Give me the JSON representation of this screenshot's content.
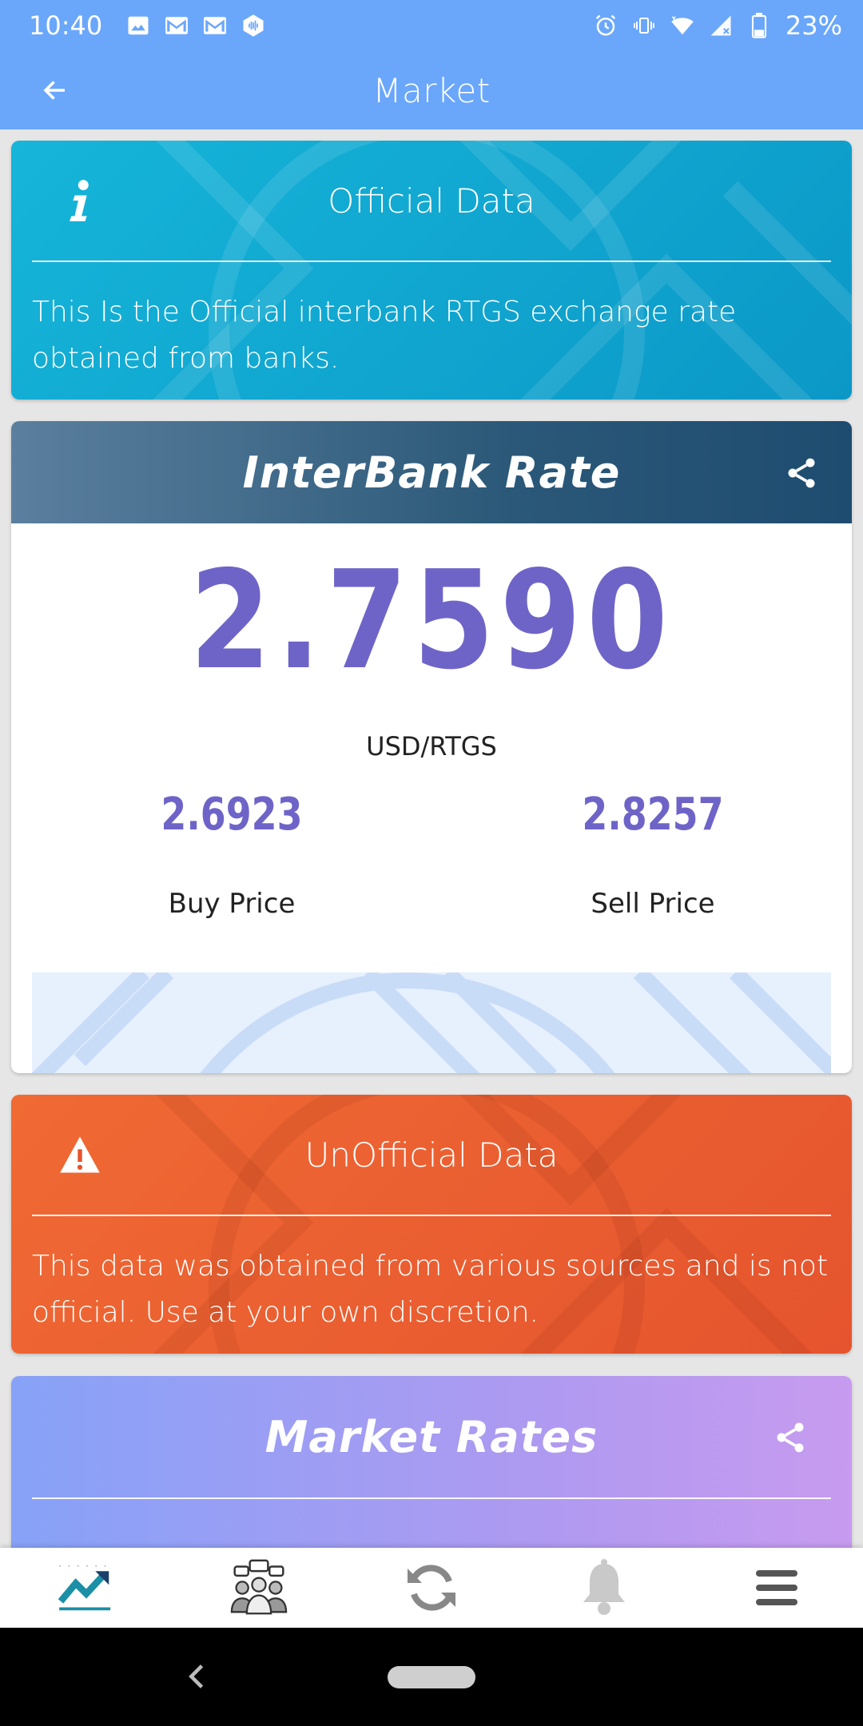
{
  "status_bar": {
    "time": "10:40",
    "battery": "23%",
    "left_icons": [
      "photo-icon",
      "gmail-icon",
      "gmail-icon",
      "podcast-icon"
    ],
    "right_icons": [
      "alarm-icon",
      "vibrate-icon",
      "wifi-icon",
      "signal-icon",
      "battery-icon"
    ]
  },
  "app_bar": {
    "title": "Market",
    "back_icon": "arrow-left-icon"
  },
  "official_card": {
    "title": "Official Data",
    "icon": "info-icon",
    "text": "This Is the Official interbank RTGS exchange rate obtained from banks."
  },
  "interbank_card": {
    "title": "InterBank Rate",
    "rate": "2.7590",
    "pair": "USD/RTGS",
    "buy_value": "2.6923",
    "buy_label": "Buy Price",
    "sell_value": "2.8257",
    "sell_label": "Sell Price"
  },
  "unofficial_card": {
    "title": "UnOfficial Data",
    "icon": "warning-icon",
    "text": "This data was obtained from various sources and is not official. Use at your own discretion."
  },
  "market_card": {
    "title": "Market Rates"
  },
  "bottom_nav": {
    "items": [
      "market-chart-icon",
      "community-icon",
      "refresh-icon",
      "bell-icon",
      "menu-icon"
    ],
    "active_index": 0
  },
  "colors": {
    "primary": "#6aa7fb",
    "rate_text": "#6e64c8",
    "info_card": "#16b5d9",
    "warning_card": "#f06a34",
    "interbank_header": "#2b5878"
  }
}
